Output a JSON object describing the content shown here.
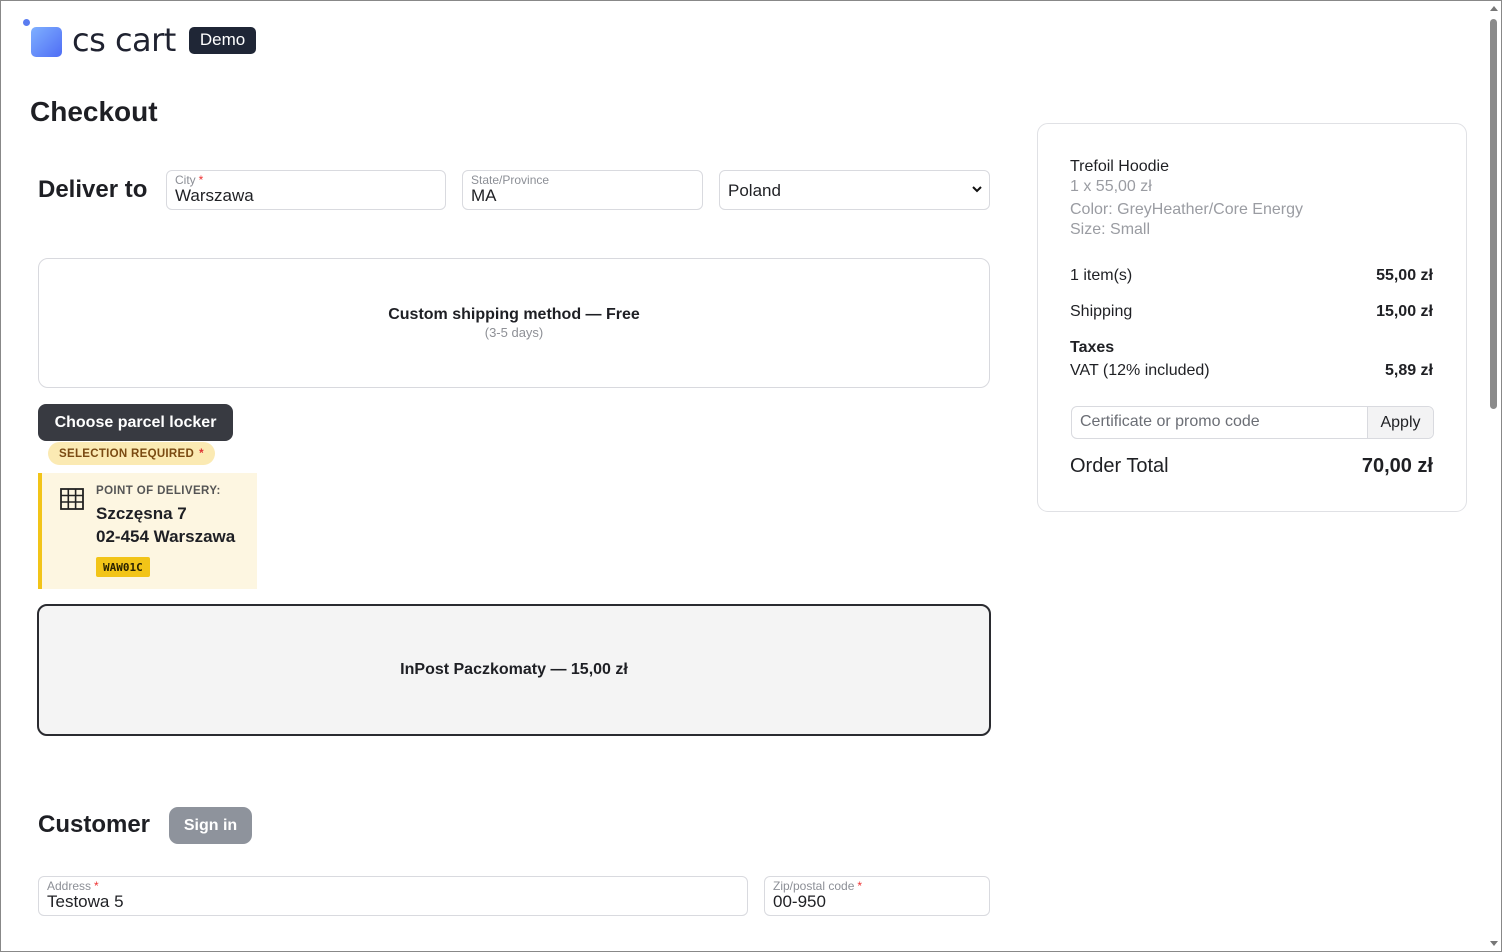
{
  "header": {
    "logo_text": "cs cart",
    "badge": "Demo"
  },
  "page": {
    "title": "Checkout"
  },
  "deliver": {
    "title": "Deliver to",
    "city": {
      "label": "City",
      "value": "Warszawa",
      "required_mark": "*"
    },
    "state": {
      "label": "State/Province",
      "value": "MA"
    },
    "country": {
      "value": "Poland"
    }
  },
  "shipping": {
    "custom": {
      "name": "Custom shipping method — Free",
      "days": "(3-5 days)"
    },
    "choose_button": "Choose parcel locker",
    "selection_required": "SELECTION REQUIRED",
    "required_mark": "*",
    "point": {
      "label": "POINT OF DELIVERY:",
      "line1": "Szczęsna 7",
      "line2": "02-454 Warszawa",
      "code": "WAW01C"
    },
    "inpost": {
      "name": "InPost Paczkomaty — 15,00 zł"
    }
  },
  "customer": {
    "title": "Customer",
    "sign_in": "Sign in",
    "address": {
      "label": "Address",
      "value": "Testowa 5",
      "required_mark": "*"
    },
    "zip": {
      "label": "Zip/postal code",
      "value": "00-950",
      "required_mark": "*"
    }
  },
  "summary": {
    "product": {
      "name": "Trefoil Hoodie",
      "qty_price": "1 x 55,00 zł",
      "color": "Color: GreyHeather/Core Energy",
      "size": "Size: Small"
    },
    "items_label": "1 item(s)",
    "items_value": "55,00 zł",
    "shipping_label": "Shipping",
    "shipping_value": "15,00 zł",
    "taxes_label": "Taxes",
    "vat_label": "VAT (12% included)",
    "vat_value": "5,89 zł",
    "promo_placeholder": "Certificate or promo code",
    "apply": "Apply",
    "total_label": "Order Total",
    "total_value": "70,00 zł"
  }
}
